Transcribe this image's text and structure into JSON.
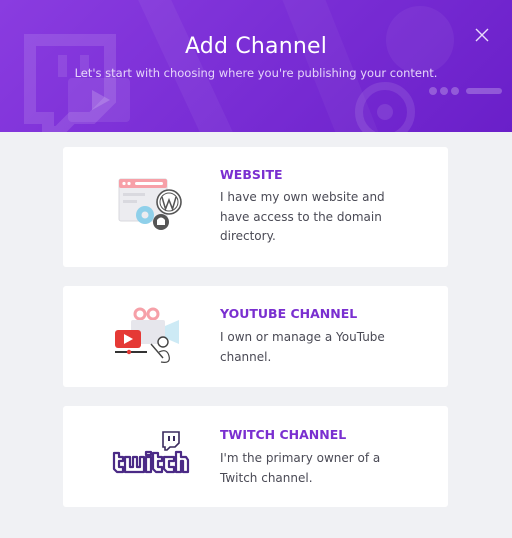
{
  "dialog": {
    "title": "Add Channel",
    "subtitle": "Let's start with choosing where you're publishing your content."
  },
  "colors": {
    "header": "#7b2fd6",
    "accent": "#7a2fd0",
    "background": "#f0f1f4"
  },
  "channels": [
    {
      "title": "WEBSITE",
      "description": "I have my own website and have access to the domain directory.",
      "icon": "website-illustration-icon"
    },
    {
      "title": "YOUTUBE CHANNEL",
      "description": "I own or manage a YouTube channel.",
      "icon": "youtube-illustration-icon"
    },
    {
      "title": "TWITCH CHANNEL",
      "description": "I'm the primary owner of a Twitch channel.",
      "icon": "twitch-logo-icon"
    }
  ]
}
